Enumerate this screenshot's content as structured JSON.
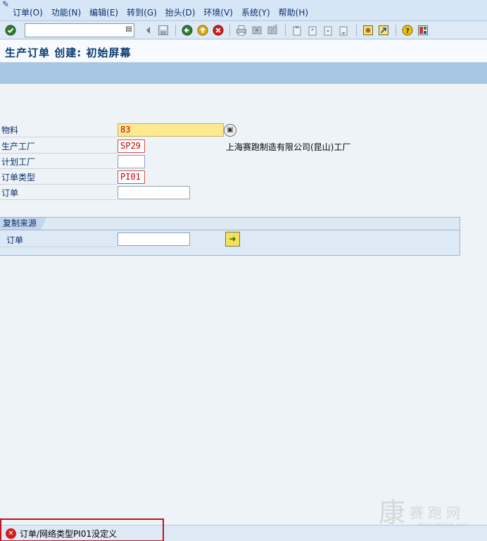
{
  "menu": {
    "items": [
      "订单(O)",
      "功能(N)",
      "编辑(E)",
      "转到(G)",
      "抬头(D)",
      "环境(V)",
      "系统(Y)",
      "帮助(H)"
    ]
  },
  "toolbar": {
    "command_value": "",
    "icons": [
      "check-icon",
      "back-icon",
      "exit-icon",
      "cancel-icon",
      "print-icon",
      "find-icon",
      "find-next-icon",
      "first-page-icon",
      "previous-page-icon",
      "next-page-icon",
      "last-page-icon",
      "create-session-icon",
      "shortcut-icon",
      "help-icon",
      "layout-menu-icon"
    ]
  },
  "title": "生产订单 创建: 初始屏幕",
  "form": {
    "material": {
      "label": "物料",
      "value": "83"
    },
    "production_plant": {
      "label": "生产工厂",
      "value": "SP29",
      "description": "上海赛跑制造有限公司(昆山)工厂"
    },
    "planning_plant": {
      "label": "计划工厂",
      "value": ""
    },
    "order_type": {
      "label": "订单类型",
      "value": "PI01"
    },
    "order": {
      "label": "订单",
      "value": ""
    }
  },
  "copy_from": {
    "title": "复制来源",
    "order_label": "订单",
    "order_value": ""
  },
  "status": {
    "type": "error",
    "message": "订单/网络类型PI01没定义"
  },
  "watermark": {
    "text": "赛跑网",
    "url": "www.saipaos.com"
  },
  "colors": {
    "error": "#d61a1a",
    "required_field": "#fde98f",
    "highlight_box": "#c0121a"
  }
}
